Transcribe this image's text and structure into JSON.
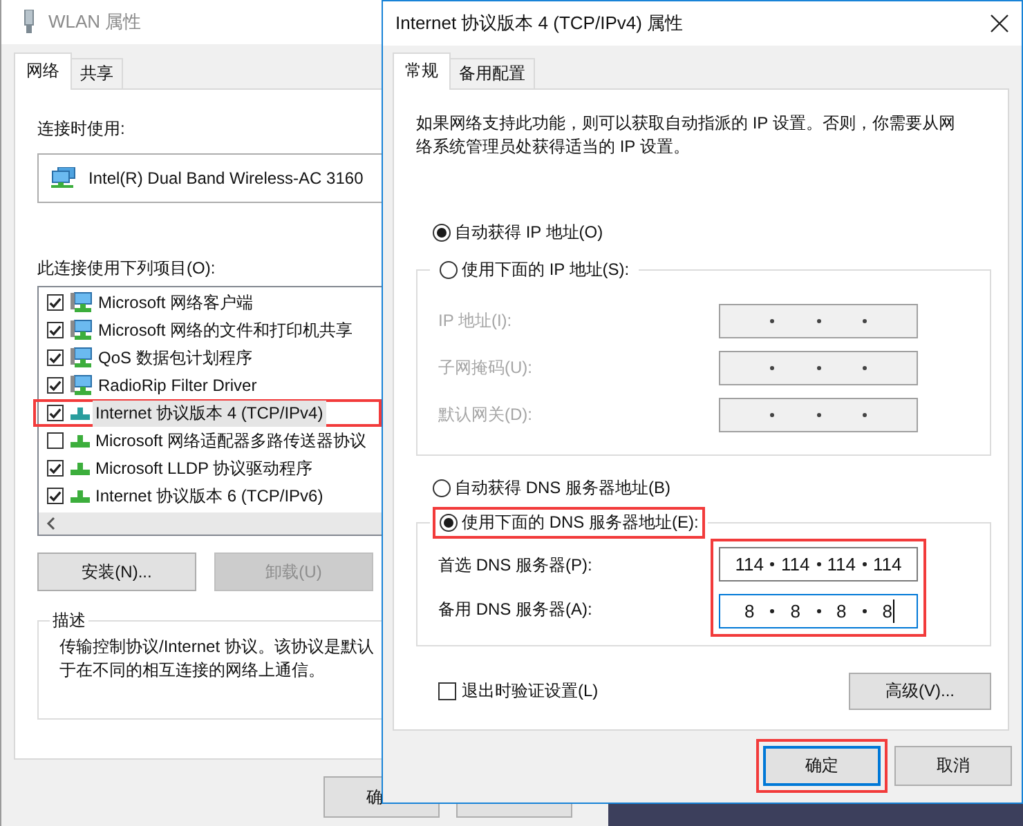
{
  "wlan_window": {
    "title": "WLAN 属性",
    "tabs": [
      {
        "label": "网络",
        "selected": true
      },
      {
        "label": "共享",
        "selected": false
      }
    ],
    "connect_label": "连接时使用:",
    "adapter": "Intel(R) Dual Band Wireless-AC 3160",
    "items_label": "此连接使用下列项目(O):",
    "items": [
      {
        "kind": "client",
        "label": "Microsoft 网络客户端",
        "checked": true,
        "selected": false,
        "highlighted": false
      },
      {
        "kind": "service",
        "label": "Microsoft 网络的文件和打印机共享",
        "checked": true,
        "selected": false,
        "highlighted": false
      },
      {
        "kind": "service",
        "label": "QoS 数据包计划程序",
        "checked": true,
        "selected": false,
        "highlighted": false
      },
      {
        "kind": "service",
        "label": "RadioRip Filter Driver",
        "checked": true,
        "selected": false,
        "highlighted": false
      },
      {
        "kind": "protocol",
        "label": "Internet 协议版本 4 (TCP/IPv4)",
        "checked": true,
        "selected": true,
        "highlighted": true
      },
      {
        "kind": "protocol",
        "label": "Microsoft 网络适配器多路传送器协议",
        "checked": false,
        "selected": false,
        "highlighted": false
      },
      {
        "kind": "protocol",
        "label": "Microsoft LLDP 协议驱动程序",
        "checked": true,
        "selected": false,
        "highlighted": false
      },
      {
        "kind": "protocol",
        "label": "Internet 协议版本 6 (TCP/IPv6)",
        "checked": true,
        "selected": false,
        "highlighted": false
      }
    ],
    "actions": [
      {
        "label": "安装(N)...",
        "disabled": false
      },
      {
        "label": "卸载(U)",
        "disabled": true
      }
    ],
    "description": {
      "title": "描述",
      "lines": [
        "传输控制协议/Internet 协议。该协议是默认",
        "于在不同的相互连接的网络上通信。"
      ]
    },
    "ok_button": "确"
  },
  "ipv4_dialog": {
    "title": "Internet 协议版本 4 (TCP/IPv4) 属性",
    "tabs": [
      {
        "label": "常规",
        "selected": true
      },
      {
        "label": "备用配置",
        "selected": false
      }
    ],
    "intro": "如果网络支持此功能，则可以获取自动指派的 IP 设置。否则，你需要从网络系统管理员处获得适当的 IP 设置。",
    "ip_modes": [
      {
        "label": "自动获得 IP 地址(O)",
        "selected": true
      },
      {
        "label": "使用下面的 IP 地址(S):",
        "selected": false
      }
    ],
    "ip_fields": [
      {
        "label": "IP 地址(I):",
        "disabled": true
      },
      {
        "label": "子网掩码(U):",
        "disabled": true
      },
      {
        "label": "默认网关(D):",
        "disabled": true
      }
    ],
    "dns_modes": [
      {
        "label": "自动获得 DNS 服务器地址(B)",
        "selected": false,
        "highlighted": false
      },
      {
        "label": "使用下面的 DNS 服务器地址(E):",
        "selected": true,
        "highlighted": true
      }
    ],
    "dns_servers": {
      "highlighted": true,
      "fields": [
        {
          "label": "首选 DNS 服务器(P):",
          "octets": [
            "114",
            "114",
            "114",
            "114"
          ],
          "disabled": false,
          "focused": false
        },
        {
          "label": "备用 DNS 服务器(A):",
          "octets": [
            "8",
            "8",
            "8",
            "8"
          ],
          "disabled": false,
          "focused": true
        }
      ]
    },
    "validate": {
      "label": "退出时验证设置(L)",
      "checked": false
    },
    "advanced_button": "高级(V)...",
    "footer_buttons": [
      {
        "label": "确定",
        "default": true,
        "highlighted": true
      },
      {
        "label": "取消",
        "default": false,
        "highlighted": false
      }
    ]
  }
}
